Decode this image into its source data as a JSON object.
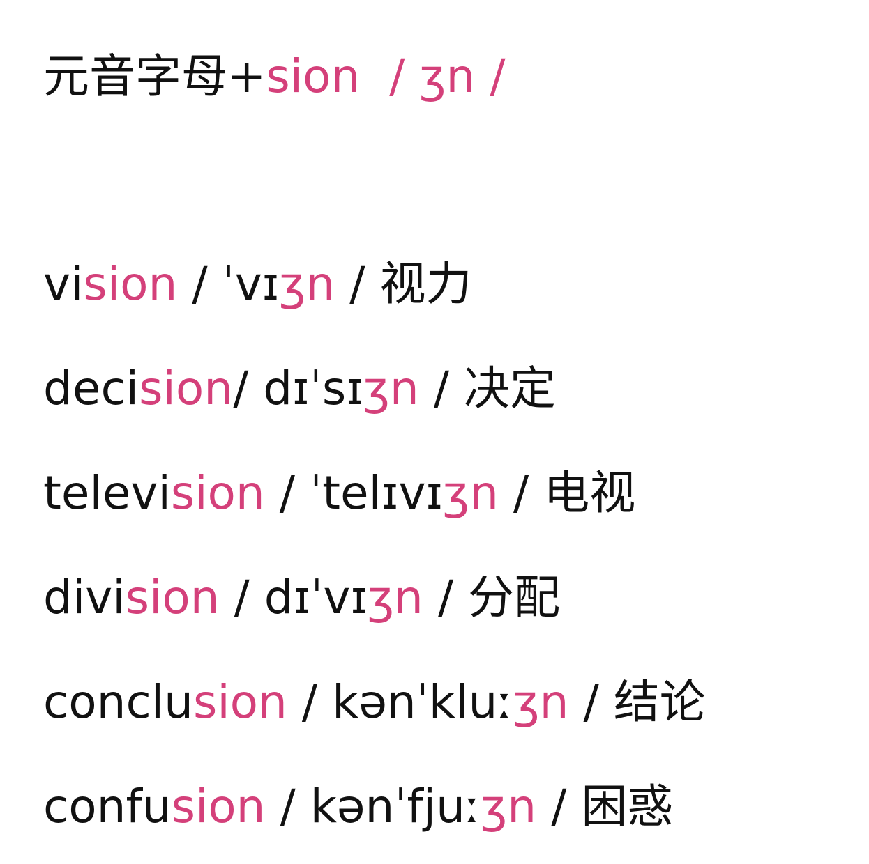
{
  "colors": {
    "text": "#111111",
    "highlight": "#d4407a"
  },
  "heading": {
    "prefix": "元音字母+",
    "suffix": "sion",
    "spacer": "  ",
    "phonetic": "/ ʒn /"
  },
  "words": [
    {
      "stem": "vi",
      "ending": "sion",
      "sep1": " / ",
      "ipa_pre": "ˈvɪ",
      "ipa_hi": "ʒn",
      "sep2": " / ",
      "meaning": "视力"
    },
    {
      "stem": "deci",
      "ending": "sion",
      "sep1": "/ ",
      "ipa_pre": "dɪˈsɪ",
      "ipa_hi": "ʒn",
      "sep2": " / ",
      "meaning": "决定"
    },
    {
      "stem": "televi",
      "ending": "sion",
      "sep1": " / ",
      "ipa_pre": "ˈtelɪvɪ",
      "ipa_hi": "ʒn",
      "sep2": " / ",
      "meaning": "电视"
    },
    {
      "stem": "divi",
      "ending": "sion",
      "sep1": " / ",
      "ipa_pre": "dɪˈvɪ",
      "ipa_hi": "ʒn",
      "sep2": " / ",
      "meaning": "分配"
    },
    {
      "stem": "conclu",
      "ending": "sion",
      "sep1": " / ",
      "ipa_pre": "kənˈkluː",
      "ipa_hi": "ʒn",
      "sep2": " / ",
      "meaning": "结论"
    },
    {
      "stem": "confu",
      "ending": "sion",
      "sep1": " / ",
      "ipa_pre": "kənˈfjuː",
      "ipa_hi": "ʒn",
      "sep2": " / ",
      "meaning": "困惑"
    }
  ]
}
